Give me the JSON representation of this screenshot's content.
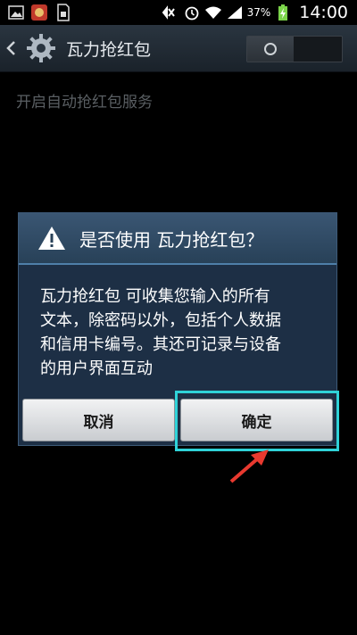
{
  "status_bar": {
    "battery_percent": "37%",
    "time": "14:00"
  },
  "action_bar": {
    "title": "瓦力抢红包"
  },
  "service": {
    "label": "开启自动抢红包服务"
  },
  "dialog": {
    "title": "是否使用 瓦力抢红包？",
    "message_lines": [
      "瓦力抢红包 可收集您输入的所有",
      "文本，除密码以外，包括个人数据",
      "和信用卡编号。其还可记录与设备",
      "的用户界面互动"
    ],
    "cancel_label": "取消",
    "confirm_label": "确定"
  },
  "colors": {
    "highlight": "#2fd2d8",
    "arrow": "#e8392f"
  }
}
